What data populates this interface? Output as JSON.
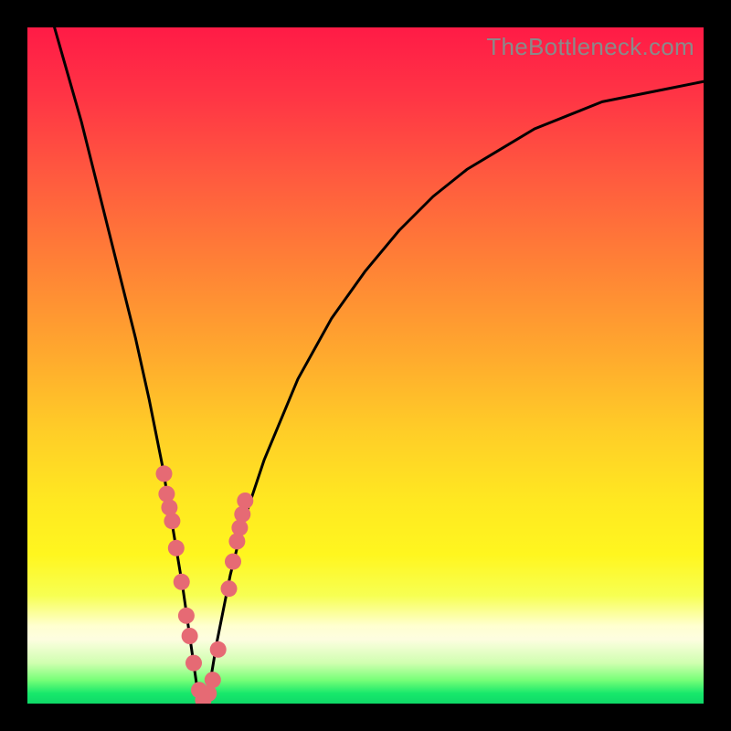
{
  "watermark": "TheBottleneck.com",
  "gradient_stops": [
    {
      "offset": 0,
      "color": "#ff1b46"
    },
    {
      "offset": 0.1,
      "color": "#ff3445"
    },
    {
      "offset": 0.22,
      "color": "#ff5a3f"
    },
    {
      "offset": 0.35,
      "color": "#ff8136"
    },
    {
      "offset": 0.48,
      "color": "#ffa82e"
    },
    {
      "offset": 0.6,
      "color": "#ffce27"
    },
    {
      "offset": 0.7,
      "color": "#ffe821"
    },
    {
      "offset": 0.78,
      "color": "#fff61f"
    },
    {
      "offset": 0.84,
      "color": "#f7ff52"
    },
    {
      "offset": 0.885,
      "color": "#ffffd0"
    },
    {
      "offset": 0.905,
      "color": "#fdfde0"
    },
    {
      "offset": 0.94,
      "color": "#d0ffb0"
    },
    {
      "offset": 0.965,
      "color": "#78ff78"
    },
    {
      "offset": 0.985,
      "color": "#17e86b"
    },
    {
      "offset": 1.0,
      "color": "#0fd968"
    }
  ],
  "dot_color": "#e66a74",
  "curve_stroke": "#000000",
  "chart_data": {
    "type": "line",
    "title": "",
    "xlabel": "",
    "ylabel": "",
    "xlim": [
      0,
      100
    ],
    "ylim": [
      0,
      100
    ],
    "note": "Axes unlabeled in source; x and y are relative 0–100. Curve is a V-shaped bottleneck curve with minimum near x≈25, y≈0. Highlighted dot markers cluster on both arms of the V near the trough (roughly y between 0 and 30).",
    "series": [
      {
        "name": "bottleneck-curve",
        "x": [
          4,
          6,
          8,
          10,
          12,
          14,
          16,
          18,
          20,
          21,
          22,
          23,
          24,
          25,
          26,
          27,
          28,
          29,
          30,
          32,
          35,
          40,
          45,
          50,
          55,
          60,
          65,
          70,
          75,
          80,
          85,
          90,
          95,
          100
        ],
        "y": [
          100,
          93,
          86,
          78,
          70,
          62,
          54,
          45,
          35,
          29,
          23,
          17,
          10,
          3,
          0,
          3,
          9,
          14,
          19,
          27,
          36,
          48,
          57,
          64,
          70,
          75,
          79,
          82,
          85,
          87,
          89,
          90,
          91,
          92
        ]
      }
    ],
    "markers": [
      {
        "series": "bottleneck-curve",
        "x": 20.2,
        "y": 34
      },
      {
        "series": "bottleneck-curve",
        "x": 20.6,
        "y": 31
      },
      {
        "series": "bottleneck-curve",
        "x": 21.0,
        "y": 29
      },
      {
        "series": "bottleneck-curve",
        "x": 21.4,
        "y": 27
      },
      {
        "series": "bottleneck-curve",
        "x": 22.0,
        "y": 23
      },
      {
        "series": "bottleneck-curve",
        "x": 22.8,
        "y": 18
      },
      {
        "series": "bottleneck-curve",
        "x": 23.5,
        "y": 13
      },
      {
        "series": "bottleneck-curve",
        "x": 24.0,
        "y": 10
      },
      {
        "series": "bottleneck-curve",
        "x": 24.6,
        "y": 6
      },
      {
        "series": "bottleneck-curve",
        "x": 25.4,
        "y": 2
      },
      {
        "series": "bottleneck-curve",
        "x": 26.0,
        "y": 0.5
      },
      {
        "series": "bottleneck-curve",
        "x": 26.8,
        "y": 1.5
      },
      {
        "series": "bottleneck-curve",
        "x": 27.4,
        "y": 3.5
      },
      {
        "series": "bottleneck-curve",
        "x": 28.2,
        "y": 8
      },
      {
        "series": "bottleneck-curve",
        "x": 29.8,
        "y": 17
      },
      {
        "series": "bottleneck-curve",
        "x": 30.4,
        "y": 21
      },
      {
        "series": "bottleneck-curve",
        "x": 31.0,
        "y": 24
      },
      {
        "series": "bottleneck-curve",
        "x": 31.4,
        "y": 26
      },
      {
        "series": "bottleneck-curve",
        "x": 31.8,
        "y": 28
      },
      {
        "series": "bottleneck-curve",
        "x": 32.2,
        "y": 30
      }
    ]
  }
}
